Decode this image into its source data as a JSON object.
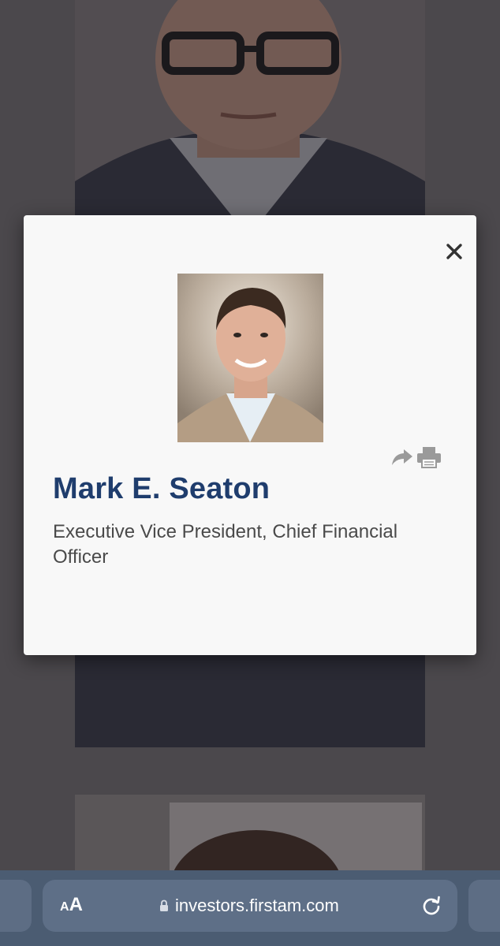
{
  "modal": {
    "name": "Mark E. Seaton",
    "title": "Executive Vice President, Chief Financial Officer",
    "icons": {
      "close": "close-icon",
      "share": "share-icon",
      "print": "print-icon"
    }
  },
  "browser": {
    "text_size_label_small": "A",
    "text_size_label_large": "A",
    "url": "investors.firstam.com",
    "icons": {
      "lock": "lock-icon",
      "reload": "reload-icon"
    }
  },
  "colors": {
    "name_color": "#1f3d6d",
    "toolbar_color": "#4b5c72"
  }
}
